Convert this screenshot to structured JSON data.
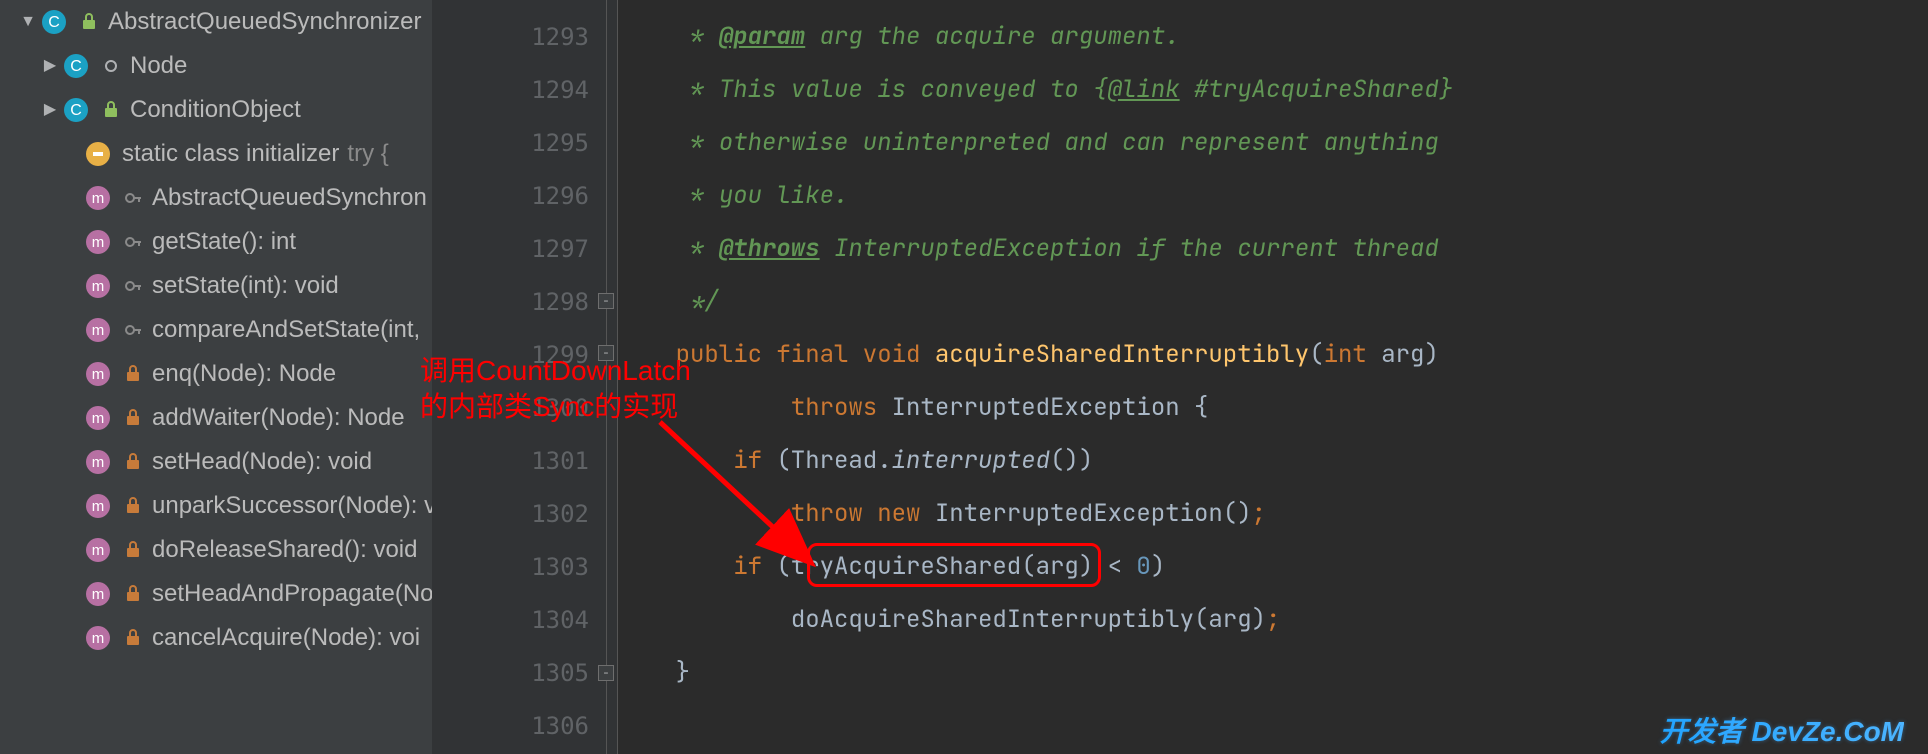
{
  "sidebar": {
    "root": {
      "label": "AbstractQueuedSynchronizer"
    },
    "node": {
      "label": "Node"
    },
    "condition": {
      "label": "ConditionObject"
    },
    "init": {
      "label": "static class initializer",
      "suffix": "try {"
    },
    "items": [
      {
        "label": "AbstractQueuedSynchron"
      },
      {
        "label": "getState(): int"
      },
      {
        "label": "setState(int): void"
      },
      {
        "label": "compareAndSetState(int,"
      },
      {
        "label": "enq(Node): Node"
      },
      {
        "label": "addWaiter(Node): Node"
      },
      {
        "label": "setHead(Node): void"
      },
      {
        "label": "unparkSuccessor(Node): v"
      },
      {
        "label": "doReleaseShared(): void"
      },
      {
        "label": "setHeadAndPropagate(No"
      },
      {
        "label": "cancelAcquire(Node): voi"
      }
    ]
  },
  "gutter": {
    "start": 1293,
    "end": 1306
  },
  "code": {
    "l1293": {
      "star": "     * ",
      "tag": "@param",
      "rest": " arg the acquire argument."
    },
    "l1294": {
      "star": "     * ",
      "rest": "This value is conveyed to {",
      "link": "@link",
      "rest2": " #tryAcquireShared}"
    },
    "l1295": {
      "star": "     * ",
      "rest": "otherwise uninterpreted and can represent anything"
    },
    "l1296": {
      "star": "     * ",
      "rest": "you like."
    },
    "l1297": {
      "star": "     * ",
      "tag": "@throws",
      "rest": " InterruptedException if the current thread"
    },
    "l1298": {
      "star": "     */"
    },
    "l1299": {
      "indent": "    ",
      "kw1": "public final void ",
      "fn": "acquireSharedInterruptibly",
      "paren": "(",
      "kw2": "int ",
      "arg": "arg",
      "close": ")"
    },
    "l1300": {
      "indent": "            ",
      "kw": "throws ",
      "ex": "InterruptedException {"
    },
    "l1301": {
      "indent": "        ",
      "kw": "if ",
      "paren": "(Thread.",
      "it": "interrupted",
      "rest": "())"
    },
    "l1302": {
      "indent": "            ",
      "kw": "throw new ",
      "ex": "InterruptedException()",
      "semi": ";"
    },
    "l1303": {
      "indent": "        ",
      "kw": "if ",
      "open": "(",
      "fn": "tryAcquireShared",
      "mid": "(arg) < ",
      "num": "0",
      "close": ")"
    },
    "l1304": {
      "indent": "            ",
      "call": "doAcquireSharedInterruptibly(arg)",
      "semi": ";"
    },
    "l1305": {
      "indent": "    }"
    },
    "l1306": {
      "blank": ""
    }
  },
  "annotation": {
    "line1": "调用CountDownLatch",
    "line2": "的内部类Sync的实现"
  },
  "watermark": "开发者 DevZe.CoM"
}
